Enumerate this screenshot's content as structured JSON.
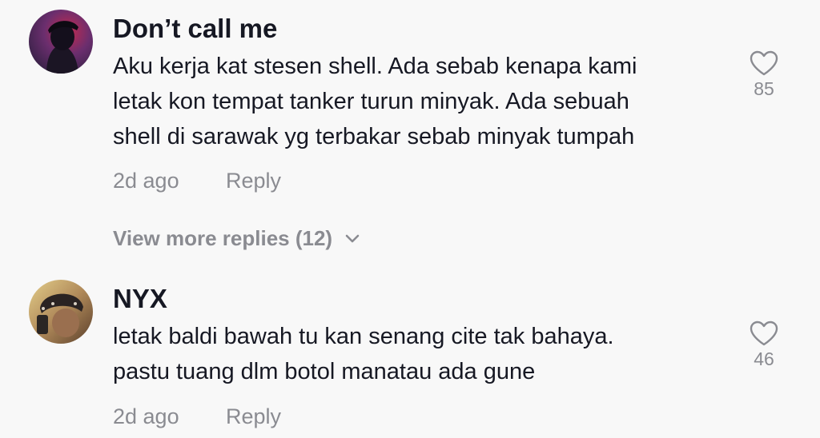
{
  "comments": [
    {
      "username": "Don’t call me",
      "lines": [
        "Aku kerja kat stesen shell. Ada sebab kenapa kami",
        "letak kon tempat tanker turun minyak. Ada sebuah",
        "shell di sarawak yg terbakar sebab minyak tumpah"
      ],
      "time": "2d ago",
      "reply_label": "Reply",
      "likes": "85",
      "like_icon": "heart-outline-icon"
    },
    {
      "username": "NYX",
      "lines": [
        "letak baldi bawah tu kan senang cite tak bahaya.",
        "pastu tuang dlm botol manatau ada gune"
      ],
      "time": "2d ago",
      "reply_label": "Reply",
      "likes": "46",
      "like_icon": "heart-outline-icon"
    }
  ],
  "view_more": {
    "label": "View more replies (12)",
    "icon": "chevron-down-icon"
  },
  "colors": {
    "background": "#f8f8f8",
    "text_primary": "#161823",
    "text_secondary": "#8a8b91"
  }
}
